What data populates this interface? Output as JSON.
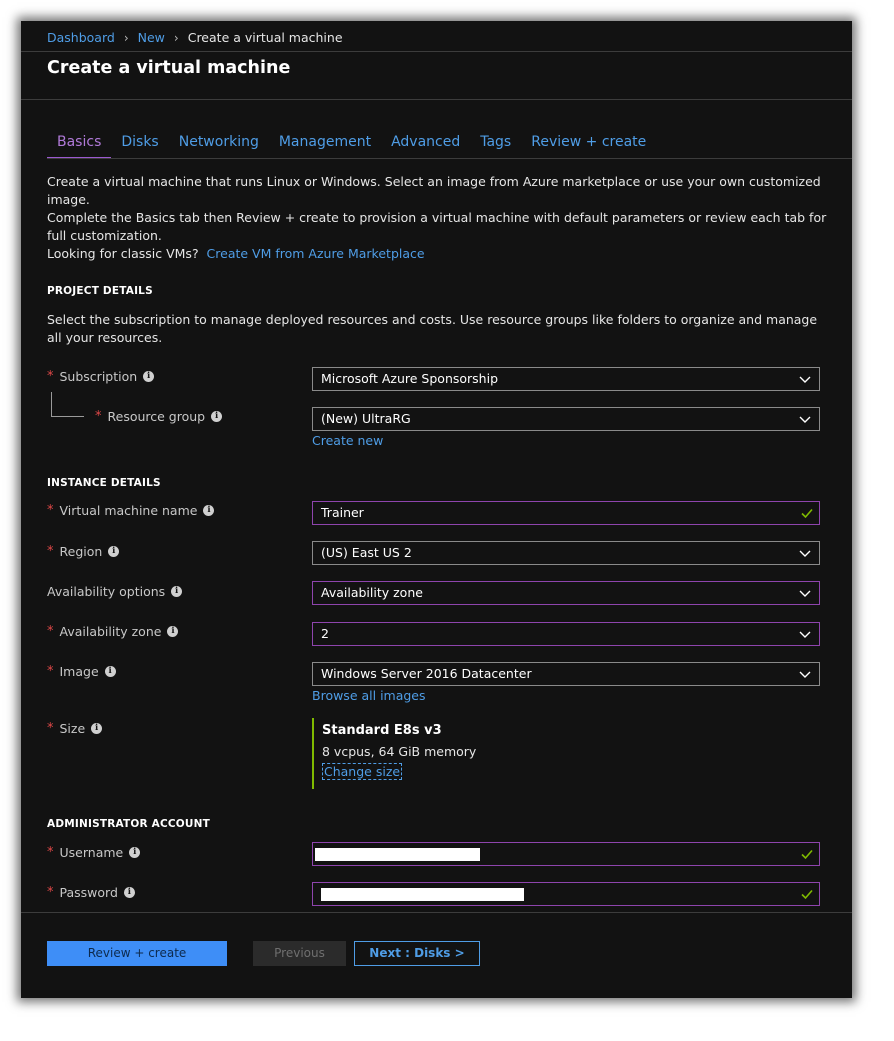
{
  "breadcrumb": {
    "items": [
      "Dashboard",
      "New"
    ],
    "current": "Create a virtual machine"
  },
  "page_title": "Create a virtual machine",
  "tabs": [
    {
      "label": "Basics",
      "active": true
    },
    {
      "label": "Disks"
    },
    {
      "label": "Networking"
    },
    {
      "label": "Management"
    },
    {
      "label": "Advanced"
    },
    {
      "label": "Tags"
    },
    {
      "label": "Review + create"
    }
  ],
  "intro": {
    "line1": "Create a virtual machine that runs Linux or Windows. Select an image from Azure marketplace or use your own customized image.",
    "line2": "Complete the Basics tab then Review + create to provision a virtual machine with default parameters or review each tab for full customization.",
    "line3_text": "Looking for classic VMs?",
    "line3_link": "Create VM from Azure Marketplace"
  },
  "project_details": {
    "heading": "PROJECT DETAILS",
    "description": "Select the subscription to manage deployed resources and costs. Use resource groups like folders to organize and manage all your resources.",
    "subscription": {
      "label": "Subscription",
      "value": "Microsoft Azure Sponsorship"
    },
    "resource_group": {
      "label": "Resource group",
      "value": "(New) UltraRG",
      "create_new": "Create new"
    }
  },
  "instance_details": {
    "heading": "INSTANCE DETAILS",
    "vm_name": {
      "label": "Virtual machine name",
      "value": "Trainer"
    },
    "region": {
      "label": "Region",
      "value": "(US) East US 2"
    },
    "availability_options": {
      "label": "Availability options",
      "value": "Availability zone"
    },
    "availability_zone": {
      "label": "Availability zone",
      "value": "2"
    },
    "image": {
      "label": "Image",
      "value": "Windows Server 2016 Datacenter",
      "browse": "Browse all images"
    },
    "size": {
      "label": "Size",
      "name": "Standard E8s v3",
      "spec": "8 vcpus, 64 GiB memory",
      "change": "Change size"
    }
  },
  "admin_account": {
    "heading": "ADMINISTRATOR ACCOUNT",
    "username": {
      "label": "Username"
    },
    "password": {
      "label": "Password"
    }
  },
  "footer": {
    "review_create": "Review + create",
    "previous": "Previous",
    "next": "Next : Disks >"
  },
  "colors": {
    "background": "#121212",
    "accent_link": "#4f9de6",
    "active_tab": "#9b59d0",
    "required": "#e04848",
    "valid_check": "#7fba00",
    "primary_button": "#3e8ef7"
  }
}
